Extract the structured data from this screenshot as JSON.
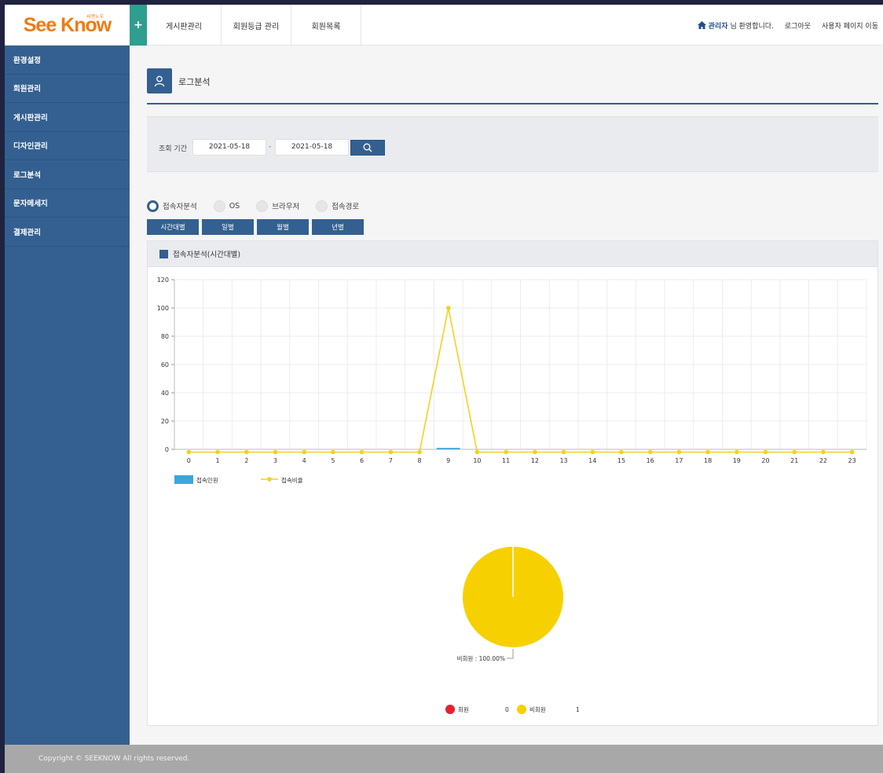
{
  "header": {
    "logo_text": "See Know",
    "logo_sub": "씨앤노우",
    "plus_label": "+",
    "tabs": [
      {
        "label": "게시판관리"
      },
      {
        "label": "회원등급 관리"
      },
      {
        "label": "회원목록"
      }
    ],
    "welcome_name": "관리자",
    "welcome_suffix": "님 환영합니다.",
    "logout": "로그아웃",
    "user_page": "사용자 페이지 이동"
  },
  "sidebar": {
    "items": [
      {
        "label": "환경설정"
      },
      {
        "label": "회원관리"
      },
      {
        "label": "게시판관리"
      },
      {
        "label": "디자인관리"
      },
      {
        "label": "로그분석"
      },
      {
        "label": "문자메세지"
      },
      {
        "label": "결제관리"
      }
    ]
  },
  "page": {
    "title": "로그분석"
  },
  "search": {
    "label": "조회 기간",
    "start_date": "2021-05-18",
    "separator": "-",
    "end_date": "2021-05-18"
  },
  "radios": [
    {
      "label": "접속자분석",
      "checked": true
    },
    {
      "label": "OS",
      "checked": false
    },
    {
      "label": "브라우저",
      "checked": false
    },
    {
      "label": "접속경로",
      "checked": false
    }
  ],
  "period_buttons": [
    {
      "label": "시간대별"
    },
    {
      "label": "일별"
    },
    {
      "label": "월별"
    },
    {
      "label": "년별"
    }
  ],
  "panel": {
    "title": "접속자분석(시간대별)"
  },
  "colors": {
    "primary": "#336090",
    "accent": "#2e9e8f",
    "logo": "#f07a12",
    "bar": "#3ba6de",
    "line": "#f2d21c",
    "member": "#e8202f",
    "nonmember": "#f7d000"
  },
  "chart_data": [
    {
      "type": "bar+line",
      "categories": [
        "0",
        "1",
        "2",
        "3",
        "4",
        "5",
        "6",
        "7",
        "8",
        "9",
        "10",
        "11",
        "12",
        "13",
        "14",
        "15",
        "16",
        "17",
        "18",
        "19",
        "20",
        "21",
        "22",
        "23"
      ],
      "ylim": [
        0,
        120
      ],
      "yticks": [
        0,
        20,
        40,
        60,
        80,
        100,
        120
      ],
      "series": [
        {
          "name": "접속인원",
          "type": "bar",
          "values": [
            0,
            0,
            0,
            0,
            0,
            0,
            0,
            0,
            0,
            1,
            0,
            0,
            0,
            0,
            0,
            0,
            0,
            0,
            0,
            0,
            0,
            0,
            0,
            0
          ]
        },
        {
          "name": "접속비율",
          "type": "line",
          "values": [
            0,
            0,
            0,
            0,
            0,
            0,
            0,
            0,
            0,
            100,
            0,
            0,
            0,
            0,
            0,
            0,
            0,
            0,
            0,
            0,
            0,
            0,
            0,
            0
          ]
        }
      ],
      "legend_position": "bottom-left",
      "grid": true
    },
    {
      "type": "pie",
      "slices": [
        {
          "name": "회원",
          "value": 0
        },
        {
          "name": "비회원",
          "value": 1
        }
      ],
      "slice_label": "비회원 : 100.00%",
      "legend_position": "bottom"
    }
  ],
  "footer": {
    "text": "Copyright © SEEKNOW All rights reserved."
  }
}
